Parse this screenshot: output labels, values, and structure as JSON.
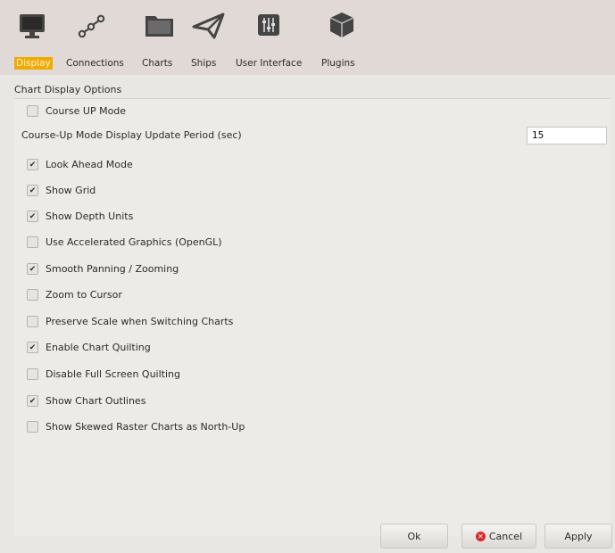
{
  "tabs": [
    {
      "label": "Display",
      "icon": "monitor-icon",
      "active": true
    },
    {
      "label": "Connections",
      "icon": "connections-icon",
      "active": false
    },
    {
      "label": "Charts",
      "icon": "folder-icon",
      "active": false
    },
    {
      "label": "Ships",
      "icon": "paper-plane-icon",
      "active": false
    },
    {
      "label": "User Interface",
      "icon": "sliders-icon",
      "active": false
    },
    {
      "label": "Plugins",
      "icon": "cube-icon",
      "active": false
    }
  ],
  "section_title": "Chart Display Options",
  "options": [
    {
      "label": "Course UP Mode",
      "checked": false
    },
    {
      "label": "Look Ahead Mode",
      "checked": true
    },
    {
      "label": "Show Grid",
      "checked": true
    },
    {
      "label": "Show Depth Units",
      "checked": true
    },
    {
      "label": "Use Accelerated Graphics (OpenGL)",
      "checked": false
    },
    {
      "label": "Smooth Panning / Zooming",
      "checked": true
    },
    {
      "label": "Zoom to Cursor",
      "checked": false
    },
    {
      "label": "Preserve Scale when Switching Charts",
      "checked": false
    },
    {
      "label": "Enable Chart Quilting",
      "checked": true
    },
    {
      "label": "Disable Full Screen Quilting",
      "checked": false
    },
    {
      "label": "Show Chart Outlines",
      "checked": true
    },
    {
      "label": "Show Skewed Raster Charts as North-Up",
      "checked": false
    }
  ],
  "update_period": {
    "label": "Course-Up Mode Display Update Period (sec)",
    "value": "15"
  },
  "buttons": {
    "ok": "Ok",
    "cancel": "Cancel",
    "apply": "Apply"
  },
  "colors": {
    "active_tab": "#f2a900",
    "cancel_icon": "#d8282a"
  }
}
